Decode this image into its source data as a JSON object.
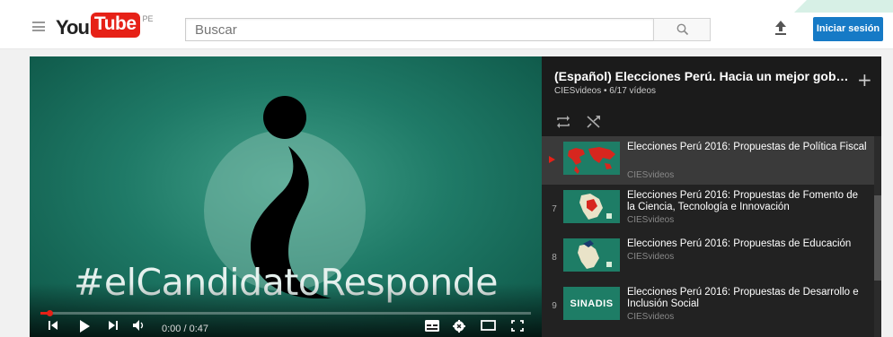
{
  "header": {
    "logo_you": "You",
    "logo_tube": "Tube",
    "country": "PE",
    "search_placeholder": "Buscar",
    "signin_label": "Iniciar sesión"
  },
  "player": {
    "overlay_text": "#elCandidatoResponde",
    "time_display": "0:00 / 0:47",
    "progress_fraction": 0.0
  },
  "playlist": {
    "title": "(Español) Elecciones Perú. Hacia un mejor gobierno 2...",
    "meta": "CIESvideos • 6/17 vídeos",
    "items": [
      {
        "index": "",
        "title": "Elecciones Perú 2016: Propuestas de Política Fiscal",
        "channel": "CIESvideos",
        "active": true,
        "thumb_text": ""
      },
      {
        "index": "7",
        "title": "Elecciones Perú 2016: Propuestas de Fomento de la Ciencia, Tecnología e Innovación",
        "channel": "CIESvideos",
        "active": false,
        "thumb_text": ""
      },
      {
        "index": "8",
        "title": "Elecciones Perú 2016: Propuestas de Educación",
        "channel": "CIESvideos",
        "active": false,
        "thumb_text": ""
      },
      {
        "index": "9",
        "title": "Elecciones Perú 2016: Propuestas de Desarrollo e Inclusión Social",
        "channel": "CIESvideos",
        "active": false,
        "thumb_text": "SINADIS"
      }
    ]
  },
  "colors": {
    "brand_red": "#e62117",
    "signin_blue": "#167ac6",
    "video_green": "#1f7a67"
  },
  "icons": {
    "menu": "hamburger-icon",
    "search": "search-icon",
    "upload": "upload-icon",
    "prev": "previous-icon",
    "play": "play-icon",
    "next": "next-icon",
    "volume": "volume-icon",
    "subtitles": "subtitles-icon",
    "settings": "gear-icon",
    "theater": "theater-mode-icon",
    "fullscreen": "fullscreen-icon",
    "add": "add-icon",
    "loop": "loop-icon",
    "shuffle": "shuffle-icon"
  }
}
